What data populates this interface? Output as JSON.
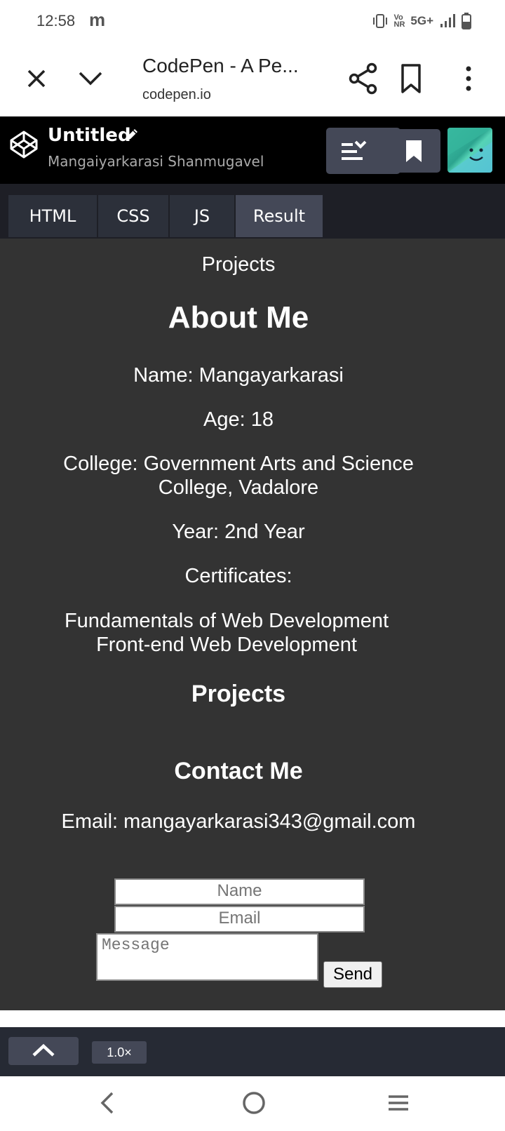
{
  "status_bar": {
    "time": "12:58",
    "app_letter": "m",
    "network": "5G+",
    "vonr": "Vo\nNR"
  },
  "browser": {
    "title": "CodePen - A Pe...",
    "url": "codepen.io",
    "icons": [
      "close-icon",
      "chevron-down-icon",
      "share-icon",
      "bookmark-icon",
      "more-vert-icon"
    ]
  },
  "codepen": {
    "pen_title": "Untitled",
    "author": "Mangaiyarkarasi Shanmugavel",
    "tabs": [
      {
        "label": "HTML",
        "active": false
      },
      {
        "label": "CSS",
        "active": false
      },
      {
        "label": "JS",
        "active": false
      },
      {
        "label": "Result",
        "active": true
      }
    ],
    "zoom": "1.0×"
  },
  "result": {
    "nav_projects": "Projects",
    "about_heading": "About Me",
    "name_line": "Name: Mangayarkarasi",
    "age_line": "Age: 18",
    "college_line1": "College: Government Arts and Science",
    "college_line2": "College, Vadalore",
    "year_line": "Year: 2nd Year",
    "certificates_label": "Certificates:",
    "certificates": [
      "Fundamentals of Web Development",
      "Front-end Web Development"
    ],
    "projects_heading": "Projects",
    "contact_heading": "Contact Me",
    "email_line": "Email: mangayarkarasi343@gmail.com",
    "form": {
      "name_placeholder": "Name",
      "email_placeholder": "Email",
      "message_placeholder": "Message",
      "send_label": "Send"
    }
  },
  "colors": {
    "result_bg": "#333333",
    "header_bg": "#000000",
    "tab_active": "#444857",
    "tab_inactive": "#2c303a"
  }
}
